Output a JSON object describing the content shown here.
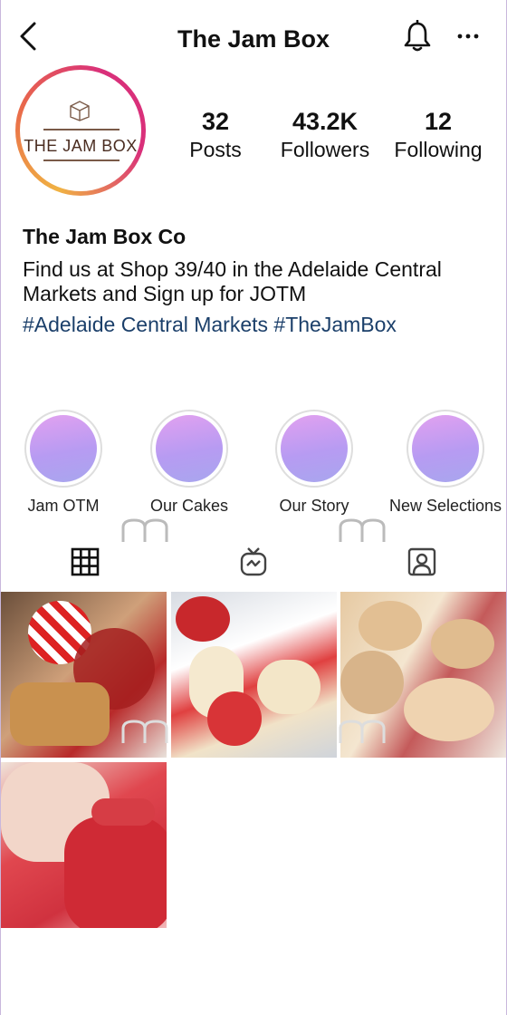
{
  "header": {
    "title": "The Jam Box"
  },
  "profile": {
    "logo_text": "THE JAM BOX",
    "stats": [
      {
        "value": "32",
        "label": "Posts"
      },
      {
        "value": "43.2K",
        "label": "Followers"
      },
      {
        "value": "12",
        "label": "Following"
      }
    ],
    "name": "The Jam Box Co",
    "bio": "Find us at Shop 39/40 in the Adelaide Central Markets and Sign up for JOTM",
    "tags": "#Adelaide Central Markets #TheJamBox"
  },
  "highlights": [
    {
      "label": "Jam OTM"
    },
    {
      "label": "Our Cakes"
    },
    {
      "label": "Our Story"
    },
    {
      "label": "New Selections"
    }
  ],
  "tabs": [
    {
      "icon": "grid-icon"
    },
    {
      "icon": "igtv-icon"
    },
    {
      "icon": "tagged-icon"
    }
  ],
  "posts": [
    {
      "icon": "photo-jam-toast"
    },
    {
      "icon": "photo-jam-crostini"
    },
    {
      "icon": "photo-jam-tarts"
    },
    {
      "icon": "photo-jam-jar"
    }
  ],
  "colors": {
    "accent_link": "#1b3f6a",
    "highlight_gradient_start": "#e2a1f0",
    "highlight_gradient_end": "#a8a6ee",
    "avatar_ring_start": "#f0b243",
    "avatar_ring_end": "#d9307a"
  }
}
